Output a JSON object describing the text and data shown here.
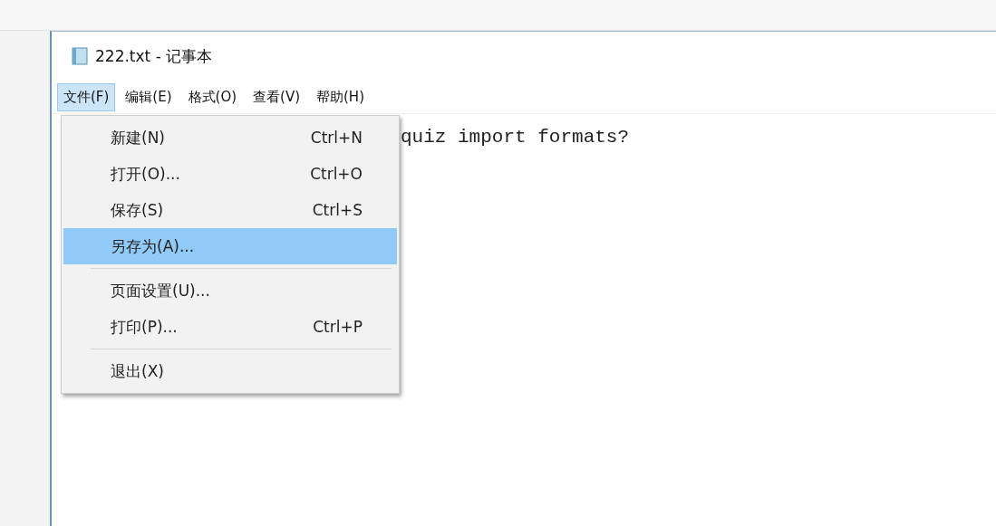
{
  "window": {
    "title": "222.txt - 记事本"
  },
  "menu_bar": [
    {
      "label": "文件(F)",
      "selected": true
    },
    {
      "label": "编辑(E)",
      "selected": false
    },
    {
      "label": "格式(O)",
      "selected": false
    },
    {
      "label": "查看(V)",
      "selected": false
    },
    {
      "label": "帮助(H)",
      "selected": false
    }
  ],
  "editor": {
    "text": "quiz import formats?"
  },
  "file_menu": [
    {
      "kind": "item",
      "label": "新建(N)",
      "shortcut": "Ctrl+N",
      "selected": false
    },
    {
      "kind": "item",
      "label": "打开(O)...",
      "shortcut": "Ctrl+O",
      "selected": false
    },
    {
      "kind": "item",
      "label": "保存(S)",
      "shortcut": "Ctrl+S",
      "selected": false
    },
    {
      "kind": "item",
      "label": "另存为(A)...",
      "selected": true
    },
    {
      "kind": "separator"
    },
    {
      "kind": "item",
      "label": "页面设置(U)...",
      "selected": false
    },
    {
      "kind": "item",
      "label": "打印(P)...",
      "shortcut": "Ctrl+P",
      "selected": false
    },
    {
      "kind": "separator"
    },
    {
      "kind": "item",
      "label": "退出(X)",
      "selected": false
    }
  ]
}
